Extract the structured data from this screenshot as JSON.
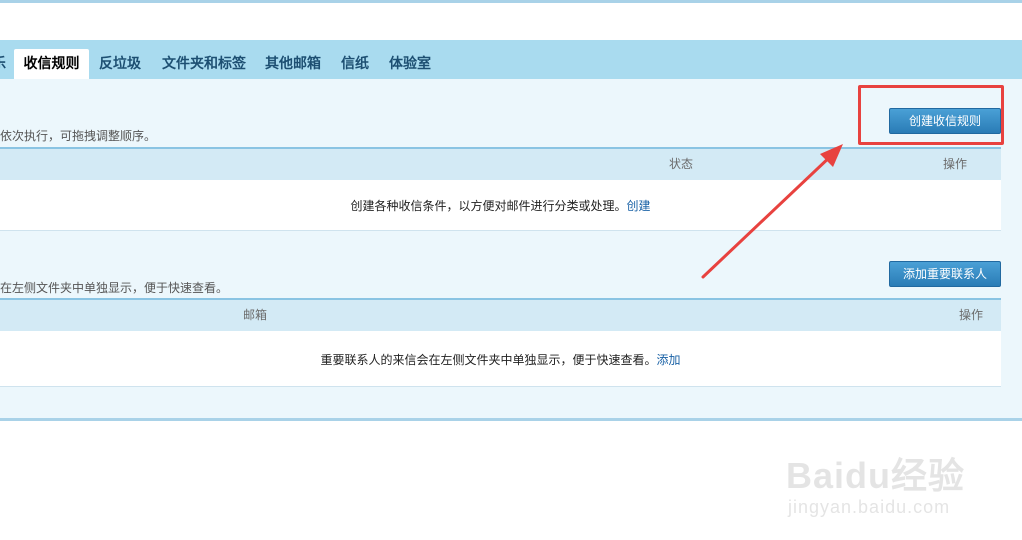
{
  "tabs": [
    {
      "label": "乐",
      "active": false
    },
    {
      "label": "收信规则",
      "active": true
    },
    {
      "label": "反垃圾",
      "active": false
    },
    {
      "label": "文件夹和标签",
      "active": false
    },
    {
      "label": "其他邮箱",
      "active": false
    },
    {
      "label": "信纸",
      "active": false
    },
    {
      "label": "体验室",
      "active": false
    }
  ],
  "rules_section": {
    "description": "依次执行，可拖拽调整顺序。",
    "create_button": "创建收信规则",
    "columns": {
      "status": "状态",
      "action": "操作"
    },
    "empty_text": "创建各种收信条件，以方便对邮件进行分类或处理。",
    "empty_link": "创建"
  },
  "contacts_section": {
    "description": "在左侧文件夹中单独显示，便于快速查看。",
    "add_button": "添加重要联系人",
    "columns": {
      "email": "邮箱",
      "action": "操作"
    },
    "empty_text": "重要联系人的来信会在左侧文件夹中单独显示，便于快速查看。",
    "empty_link": "添加"
  },
  "annotation": {
    "color": "#e8423f"
  },
  "watermark": {
    "logo": "Baidu经验",
    "url": "jingyan.baidu.com"
  }
}
